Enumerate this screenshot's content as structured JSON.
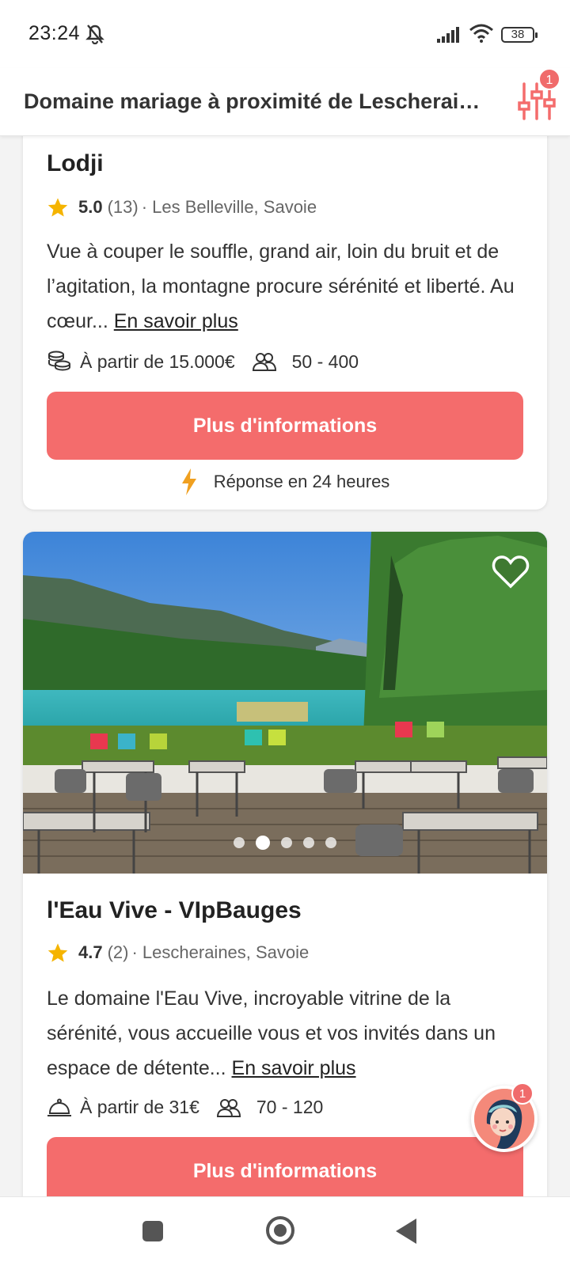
{
  "status": {
    "time": "23:24",
    "battery": "38"
  },
  "header": {
    "title": "Domaine mariage à proximité de Lescheraines",
    "filter_badge": "1"
  },
  "venues": [
    {
      "name": "Lodji",
      "rating": "5.0",
      "reviews": "(13)",
      "location": "· Les Belleville, Savoie",
      "description": "Vue à couper le souffle, grand air, loin du bruit et de l’agitation, la montagne procure sérénité et liberté. Au cœur...",
      "more_label": "En savoir plus",
      "price": "À partir de 15.000€",
      "guests": "50 - 400",
      "cta": "Plus d'informations",
      "response": "Réponse en 24 heures"
    },
    {
      "name": "l'Eau Vive - VIpBauges",
      "rating": "4.7",
      "reviews": "(2)",
      "location": "· Lescheraines, Savoie",
      "description": "Le domaine l'Eau Vive, incroyable vitrine de la sérénité, vous accueille vous et vos invités dans un espace de détente...",
      "more_label": "En savoir plus",
      "price": "À partir de 31€",
      "guests": "70 - 120",
      "cta": "Plus d'informations",
      "photo_dots": 5,
      "active_dot": 2
    }
  ],
  "chat": {
    "badge": "1"
  },
  "colors": {
    "accent": "#f46c6c",
    "star": "#f5b400",
    "bolt": "#f0a020"
  }
}
